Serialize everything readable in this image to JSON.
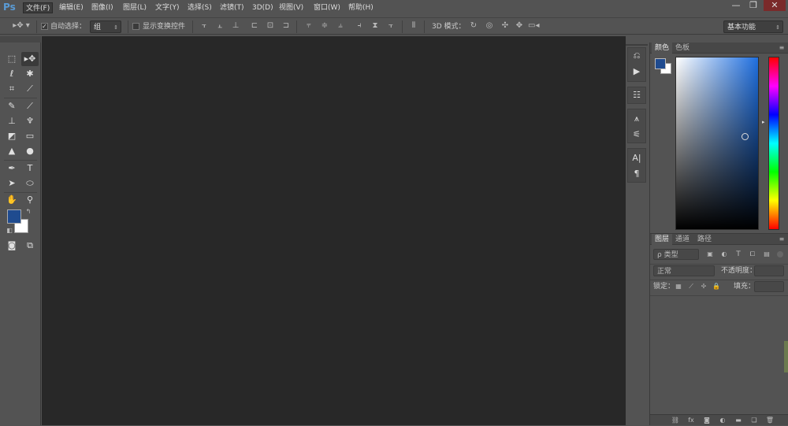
{
  "app": {
    "logo": "Ps"
  },
  "menu": [
    {
      "label": "文件(F)"
    },
    {
      "label": "编辑(E)"
    },
    {
      "label": "图像(I)"
    },
    {
      "label": "图层(L)"
    },
    {
      "label": "文字(Y)"
    },
    {
      "label": "选择(S)"
    },
    {
      "label": "滤镜(T)"
    },
    {
      "label": "3D(D)"
    },
    {
      "label": "视图(V)"
    },
    {
      "label": "窗口(W)"
    },
    {
      "label": "帮助(H)"
    }
  ],
  "window_controls": {
    "minimize": "—",
    "restore": "❐",
    "close": "✕"
  },
  "options": {
    "auto_select_label": "自动选择：",
    "auto_select_value": "组",
    "show_transform_label": "显示变换控件",
    "mode3d_label": "3D 模式：",
    "workspace": "基本功能"
  },
  "color_panel": {
    "tabs": [
      {
        "label": "颜色"
      },
      {
        "label": "色板"
      }
    ],
    "colors": {
      "foreground": "#1f4b8f",
      "background": "#ffffff",
      "gradient_hue": "#1f6fe0"
    }
  },
  "layers_panel": {
    "tabs": [
      {
        "label": "图层"
      },
      {
        "label": "通道"
      },
      {
        "label": "路径"
      }
    ],
    "filter_kind": "ρ 类型",
    "blend_mode": "正常",
    "opacity_label": "不透明度：",
    "lock_label": "锁定：",
    "fill_label": "填充："
  }
}
